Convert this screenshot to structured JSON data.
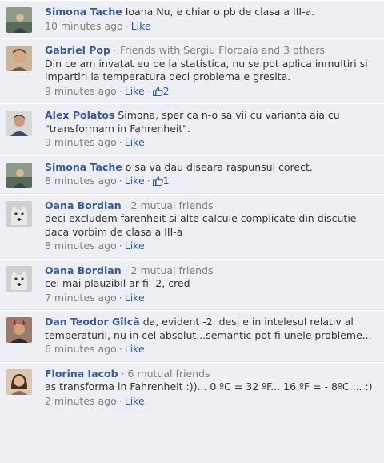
{
  "comments": [
    {
      "author": "Simona Tache",
      "friends_note": "",
      "text": "Ioana Nu, e chiar o pb de clasa a III-a.",
      "time": "10 minutes ago",
      "like_label": "Like",
      "likes": "",
      "avatar_icon": "profile-photo-icon"
    },
    {
      "author": "Gabriel Pop",
      "friends_note": "· Friends with Sergiu Floroaia and 3 others",
      "text": "Din ce am invatat eu pe la statistica, nu se pot aplica inmultiri si impartiri la temperatura deci problema e gresita.",
      "time": "9 minutes ago",
      "like_label": "Like",
      "likes": "2",
      "avatar_icon": "profile-photo-icon"
    },
    {
      "author": "Alex Polatos",
      "friends_note": "",
      "text": "Simona, sper ca n-o sa vii cu varianta aia cu \"transformam in Fahrenheit\".",
      "time": "9 minutes ago",
      "like_label": "Like",
      "likes": "",
      "avatar_icon": "profile-photo-icon"
    },
    {
      "author": "Simona Tache",
      "friends_note": "",
      "text": "o sa va dau diseara raspunsul corect.",
      "time": "8 minutes ago",
      "like_label": "Like",
      "likes": "1",
      "avatar_icon": "profile-photo-icon"
    },
    {
      "author": "Oana Bordian",
      "friends_note": "· 2 mutual friends",
      "text": "deci excludem farenheit si alte calcule complicate din discutie daca vorbim de clasa a III-a",
      "time": "8 minutes ago",
      "like_label": "Like",
      "likes": "",
      "avatar_icon": "cat-photo-icon"
    },
    {
      "author": "Oana Bordian",
      "friends_note": "· 2 mutual friends",
      "text": "cel mai plauzibil ar fi -2, cred",
      "time": "7 minutes ago",
      "like_label": "Like",
      "likes": "",
      "avatar_icon": "cat-photo-icon"
    },
    {
      "author": "Dan Teodor Gîlcă",
      "friends_note": "",
      "text": "da, evident -2, desi e in intelesul relativ al temperaturii, nu in cel absolut...semantic pot fi unele probleme...",
      "time": "6 minutes ago",
      "like_label": "Like",
      "likes": "",
      "avatar_icon": "profile-photo-icon"
    },
    {
      "author": "Florina Iacob",
      "friends_note": "· 6 mutual friends",
      "text": "as transforma in Fahrenheit :))... 0 ºC = 32 ºF... 16 ºF = - 8ºC ... :)",
      "time": "2 minutes ago",
      "like_label": "Like",
      "likes": "",
      "avatar_icon": "profile-photo-icon"
    }
  ],
  "colors": {
    "link": "#3b5998",
    "meta": "#808080",
    "background": "#edeff4"
  }
}
